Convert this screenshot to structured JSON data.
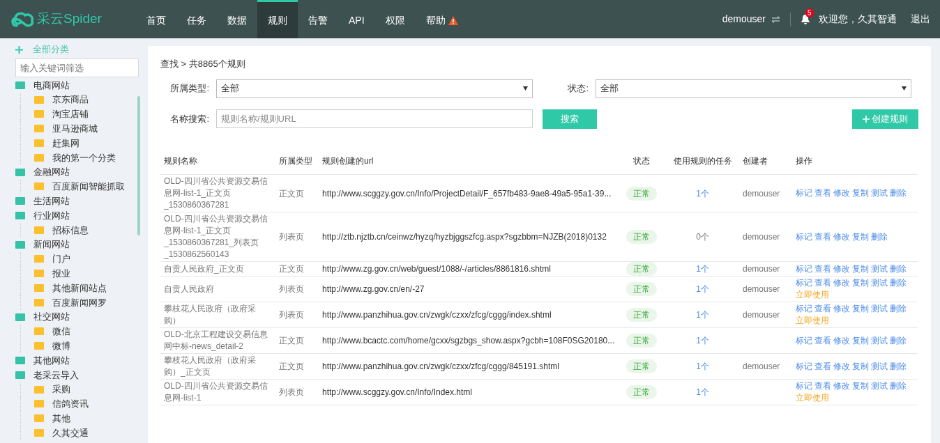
{
  "header": {
    "logo": "采云Spider",
    "nav": [
      {
        "label": "首页",
        "selected": false,
        "warning": false
      },
      {
        "label": "任务",
        "selected": false,
        "warning": false
      },
      {
        "label": "数据",
        "selected": false,
        "warning": false
      },
      {
        "label": "规则",
        "selected": true,
        "warning": false
      },
      {
        "label": "告警",
        "selected": false,
        "warning": false
      },
      {
        "label": "API",
        "selected": false,
        "warning": false
      },
      {
        "label": "权限",
        "selected": false,
        "warning": false
      },
      {
        "label": "帮助",
        "selected": false,
        "warning": true
      }
    ],
    "user": "demouser",
    "notifications": "5",
    "welcome": "欢迎您，久其智通",
    "logout": "退出"
  },
  "sidebar": {
    "all_label": "全部分类",
    "filter_placeholder": "输入关键词筛选",
    "tree": [
      {
        "label": "电商网站",
        "children": [
          {
            "label": "京东商品"
          },
          {
            "label": "淘宝店铺"
          },
          {
            "label": "亚马逊商城"
          },
          {
            "label": "赶集网"
          },
          {
            "label": "我的第一个分类"
          }
        ]
      },
      {
        "label": "金融网站",
        "children": [
          {
            "label": "百度新闻智能抓取"
          }
        ]
      },
      {
        "label": "生活网站"
      },
      {
        "label": "行业网站",
        "children": [
          {
            "label": "招标信息"
          }
        ]
      },
      {
        "label": "新闻网站",
        "children": [
          {
            "label": "门户"
          },
          {
            "label": "报业"
          },
          {
            "label": "其他新闻站点"
          },
          {
            "label": "百度新闻网罗"
          }
        ]
      },
      {
        "label": "社交网站",
        "children": [
          {
            "label": "微信"
          },
          {
            "label": "微博"
          }
        ]
      },
      {
        "label": "其他网站"
      },
      {
        "label": "老采云导入",
        "children": [
          {
            "label": "采购"
          },
          {
            "label": "信鸽资讯"
          },
          {
            "label": "其他"
          },
          {
            "label": "久其交通"
          }
        ]
      }
    ]
  },
  "main": {
    "breadcrumb": "查找 > 共8865个规则",
    "filters": {
      "type_label": "所属类型:",
      "type_value": "全部",
      "status_label": "状态:",
      "status_value": "全部",
      "search_label": "名称搜索:",
      "search_placeholder": "规则名称/规则URL",
      "search_button": "搜索",
      "create_button": "创建规则"
    },
    "table": {
      "columns": [
        "规则名称",
        "所属类型",
        "规则创建的url",
        "状态",
        "使用规则的任务",
        "创建者",
        "操作"
      ],
      "rows": [
        {
          "name": "OLD-四川省公共资源交易信息网-list-1_正文页_1530860367281",
          "type": "正文页",
          "url": "http://www.scggzy.gov.cn/Info/ProjectDetail/F_657fb483-9ae8-49a5-95a1-39...",
          "status": "正常",
          "tasks": "1个",
          "creator": "demouser",
          "actions": [
            {
              "label": "标记",
              "kind": "link"
            },
            {
              "label": "查看",
              "kind": "link"
            },
            {
              "label": "修改",
              "kind": "link"
            },
            {
              "label": "复制",
              "kind": "link"
            },
            {
              "label": "测试",
              "kind": "link"
            },
            {
              "label": "删除",
              "kind": "link"
            }
          ]
        },
        {
          "name": "OLD-四川省公共资源交易信息网-list-1_正文页_1530860367281_列表页_1530862560143",
          "type": "列表页",
          "url": "http://ztb.njztb.cn/ceinwz/hyzq/hyzbjggszfcg.aspx?sgzbbm=NJZB(2018)0132",
          "status": "正常",
          "tasks": "0个",
          "creator": "demouser",
          "actions": [
            {
              "label": "标记",
              "kind": "link"
            },
            {
              "label": "查看",
              "kind": "link"
            },
            {
              "label": "修改",
              "kind": "link"
            },
            {
              "label": "复制",
              "kind": "link"
            },
            {
              "label": "删除",
              "kind": "link"
            }
          ]
        },
        {
          "name": "自贡人民政府_正文页",
          "type": "正文页",
          "url": "http://www.zg.gov.cn/web/guest/1088/-/articles/8861816.shtml",
          "status": "正常",
          "tasks": "1个",
          "creator": "demouser",
          "actions": [
            {
              "label": "标记",
              "kind": "link"
            },
            {
              "label": "查看",
              "kind": "link"
            },
            {
              "label": "修改",
              "kind": "link"
            },
            {
              "label": "复制",
              "kind": "link"
            },
            {
              "label": "测试",
              "kind": "link"
            },
            {
              "label": "删除",
              "kind": "link"
            }
          ]
        },
        {
          "name": "自贡人民政府",
          "type": "列表页",
          "url": "http://www.zg.gov.cn/en/-27",
          "status": "正常",
          "tasks": "1个",
          "creator": "demouser",
          "actions": [
            {
              "label": "标记",
              "kind": "link"
            },
            {
              "label": "查看",
              "kind": "link"
            },
            {
              "label": "修改",
              "kind": "link"
            },
            {
              "label": "复制",
              "kind": "link"
            },
            {
              "label": "测试",
              "kind": "link"
            },
            {
              "label": "删除",
              "kind": "link"
            },
            {
              "label": "立即使用",
              "kind": "use"
            }
          ]
        },
        {
          "name": "攀枝花人民政府（政府采购）",
          "type": "列表页",
          "url": "http://www.panzhihua.gov.cn/zwgk/czxx/zfcg/cggg/index.shtml",
          "status": "正常",
          "tasks": "1个",
          "creator": "demouser",
          "actions": [
            {
              "label": "标记",
              "kind": "link"
            },
            {
              "label": "查看",
              "kind": "link"
            },
            {
              "label": "修改",
              "kind": "link"
            },
            {
              "label": "复制",
              "kind": "link"
            },
            {
              "label": "测试",
              "kind": "link"
            },
            {
              "label": "删除",
              "kind": "link"
            },
            {
              "label": "立即使用",
              "kind": "use"
            }
          ]
        },
        {
          "name": "OLD-北京工程建设交易信息网中标-news_detail-2",
          "type": "正文页",
          "url": "http://www.bcactc.com/home/gcxx/sgzbgs_show.aspx?gcbh=108F0SG20180...",
          "status": "正常",
          "tasks": "1个",
          "actions": [
            {
              "label": "标记",
              "kind": "link"
            },
            {
              "label": "查看",
              "kind": "link"
            },
            {
              "label": "修改",
              "kind": "link"
            },
            {
              "label": "复制",
              "kind": "link"
            },
            {
              "label": "测试",
              "kind": "link"
            },
            {
              "label": "删除",
              "kind": "link"
            }
          ]
        },
        {
          "name": "攀枝花人民政府（政府采购）_正文页",
          "type": "正文页",
          "url": "http://www.panzhihua.gov.cn/zwgk/czxx/zfcg/cggg/845191.shtml",
          "status": "正常",
          "tasks": "1个",
          "creator": "demouser",
          "actions": [
            {
              "label": "标记",
              "kind": "link"
            },
            {
              "label": "查看",
              "kind": "link"
            },
            {
              "label": "修改",
              "kind": "link"
            },
            {
              "label": "复制",
              "kind": "link"
            },
            {
              "label": "测试",
              "kind": "link"
            },
            {
              "label": "删除",
              "kind": "link"
            }
          ]
        },
        {
          "name": "OLD-四川省公共资源交易信息网-list-1",
          "type": "列表页",
          "url": "http://www.scggzy.gov.cn/Info/Index.html",
          "status": "正常",
          "tasks": "1个",
          "actions": [
            {
              "label": "标记",
              "kind": "link"
            },
            {
              "label": "查看",
              "kind": "link"
            },
            {
              "label": "修改",
              "kind": "link"
            },
            {
              "label": "复制",
              "kind": "link"
            },
            {
              "label": "测试",
              "kind": "link"
            },
            {
              "label": "删除",
              "kind": "link"
            },
            {
              "label": "立即使用",
              "kind": "use"
            }
          ]
        }
      ]
    }
  }
}
